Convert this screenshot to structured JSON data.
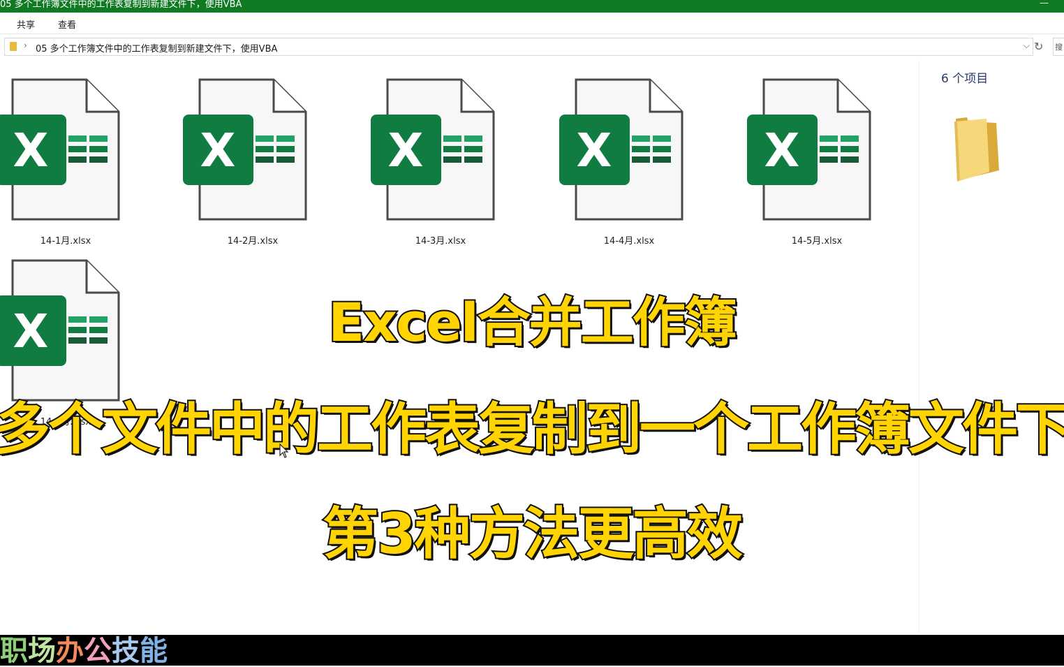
{
  "window": {
    "title": "05 多个工作簿文件中的工作表复制到新建文件下，使用VBA",
    "minimize_glyph": "—"
  },
  "ribbon": {
    "tabs": [
      "共享",
      "查看"
    ]
  },
  "address": {
    "path": "05 多个工作簿文件中的工作表复制到新建文件下，使用VBA",
    "search_stub": "搜"
  },
  "files": [
    {
      "name": "14-1月.xlsx",
      "icon": "excel-file-icon"
    },
    {
      "name": "14-2月.xlsx",
      "icon": "excel-file-icon"
    },
    {
      "name": "14-3月.xlsx",
      "icon": "excel-file-icon"
    },
    {
      "name": "14-4月.xlsx",
      "icon": "excel-file-icon"
    },
    {
      "name": "14-5月.xlsx",
      "icon": "excel-file-icon"
    },
    {
      "name": "14-6月.xlsx",
      "icon": "excel-file-icon"
    }
  ],
  "preview": {
    "item_count": "6 个项目",
    "icon": "folder-icon"
  },
  "overlay": {
    "line1": "Excel合并工作簿",
    "line2": "多个文件中的工作表复制到一个工作簿文件下",
    "line3": "第3种方法更高效"
  },
  "brand": {
    "chars": [
      "职",
      "场",
      "办",
      "公",
      "技",
      "能"
    ],
    "colors": [
      "#8fcf7a",
      "#bfe6a0",
      "#f28a5c",
      "#f4a0b8",
      "#a8c8f0",
      "#7fb3e6"
    ]
  },
  "colors": {
    "excel_green": "#107c41",
    "title_bar": "#0e7a22",
    "caption_yellow": "#ffd400"
  }
}
